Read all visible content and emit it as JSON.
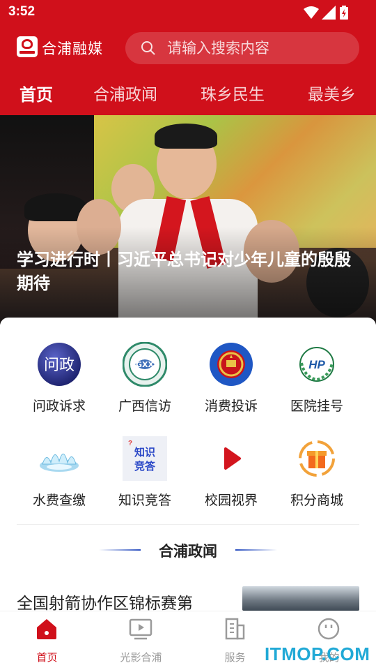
{
  "status_bar": {
    "time": "3:52"
  },
  "header": {
    "app_name": "合浦融媒",
    "search": {
      "placeholder": "请输入搜索内容"
    }
  },
  "tabs": [
    {
      "label": "首页",
      "active": true
    },
    {
      "label": "合浦政闻",
      "active": false
    },
    {
      "label": "珠乡民生",
      "active": false
    },
    {
      "label": "最美乡",
      "active": false
    }
  ],
  "banner": {
    "title": "学习进行时丨习近平总书记对少年儿童的殷殷期待"
  },
  "services": [
    {
      "label": "问政诉求",
      "icon": "wenzheng-icon",
      "icon_text": "问政"
    },
    {
      "label": "广西信访",
      "icon": "xinfang-icon",
      "icon_text": ""
    },
    {
      "label": "消费投诉",
      "icon": "emblem-icon",
      "icon_text": ""
    },
    {
      "label": "医院挂号",
      "icon": "hospital-icon",
      "icon_text": "HP"
    },
    {
      "label": "水费查缴",
      "icon": "water-splash-icon",
      "icon_text": ""
    },
    {
      "label": "知识竞答",
      "icon": "quiz-icon",
      "icon_text": "知识竞答"
    },
    {
      "label": "校园视界",
      "icon": "play-icon",
      "icon_text": ""
    },
    {
      "label": "积分商城",
      "icon": "gift-icon",
      "icon_text": ""
    }
  ],
  "section": {
    "title": "合浦政闻"
  },
  "news": [
    {
      "title": "全国射箭协作区锦标赛第"
    }
  ],
  "bottom_nav": [
    {
      "label": "首页",
      "icon": "home-icon",
      "active": true
    },
    {
      "label": "光影合浦",
      "icon": "video-icon",
      "active": false
    },
    {
      "label": "服务",
      "icon": "building-icon",
      "active": false
    },
    {
      "label": "我的",
      "icon": "profile-icon",
      "active": false
    }
  ],
  "watermark": "ITMOP.COM",
  "colors": {
    "brand_red": "#d0101b",
    "section_line": "#2a4fc0"
  }
}
